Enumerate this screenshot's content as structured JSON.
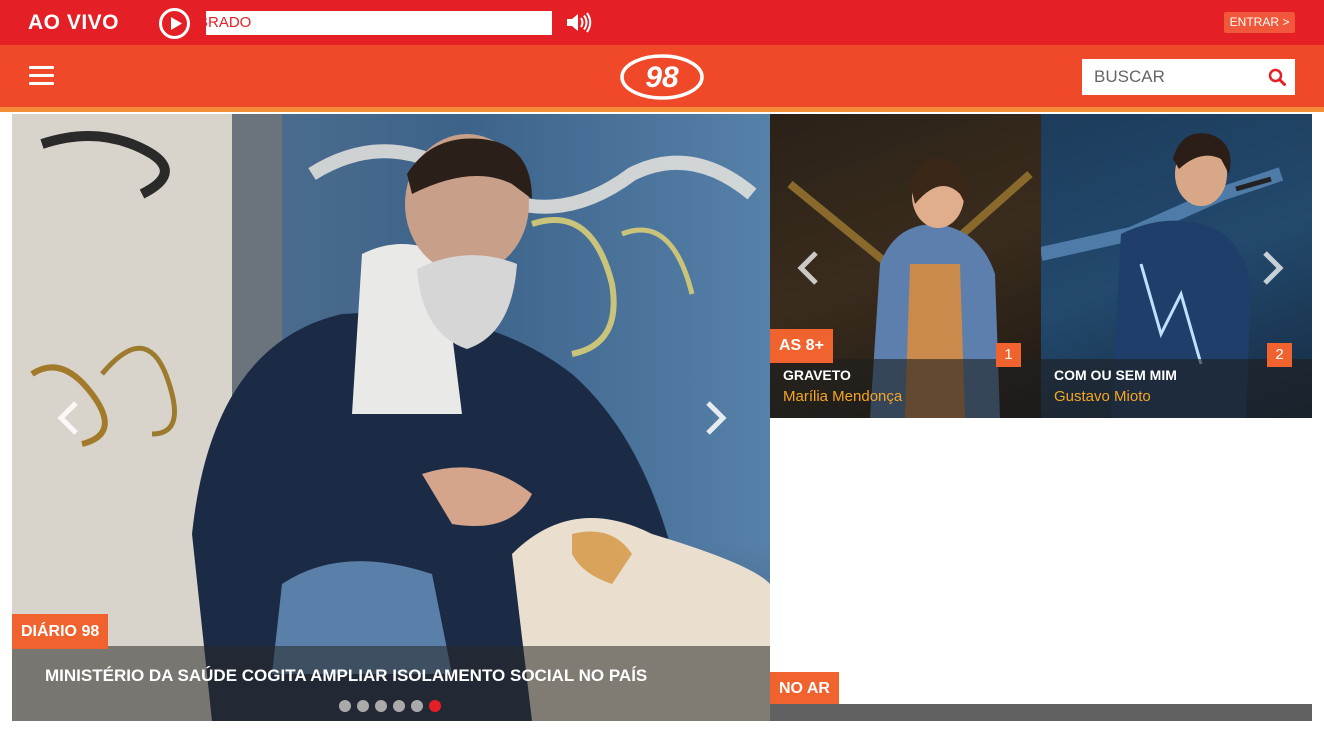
{
  "live_bar": {
    "label": "AO VIVO",
    "ticker_text": "BRADO",
    "login_label": "ENTRAR >"
  },
  "header": {
    "logo_text": "98",
    "search_placeholder": "BUSCAR"
  },
  "main_slider": {
    "tag": "DIÁRIO 98",
    "headline": "MINISTÉRIO DA SAÚDE COGITA AMPLIAR ISOLAMENTO SOCIAL NO PAÍS",
    "dots_total": 6,
    "active_dot": 6
  },
  "top8": {
    "tag": "AS 8+",
    "items": [
      {
        "rank": "1",
        "title": "GRAVETO",
        "artist": "Marília Mendonça"
      },
      {
        "rank": "2",
        "title": "COM OU SEM MIM",
        "artist": "Gustavo Mioto"
      }
    ]
  },
  "no_ar": {
    "tag": "NO AR"
  },
  "colors": {
    "live_red": "#e41f25",
    "header_orange": "#f0492a",
    "tag_orange": "#f0622e",
    "artist_yellow": "#f5a623"
  },
  "icons": [
    "play-icon",
    "volume-icon",
    "menu-icon",
    "search-icon",
    "chevron-left-icon",
    "chevron-right-icon"
  ]
}
